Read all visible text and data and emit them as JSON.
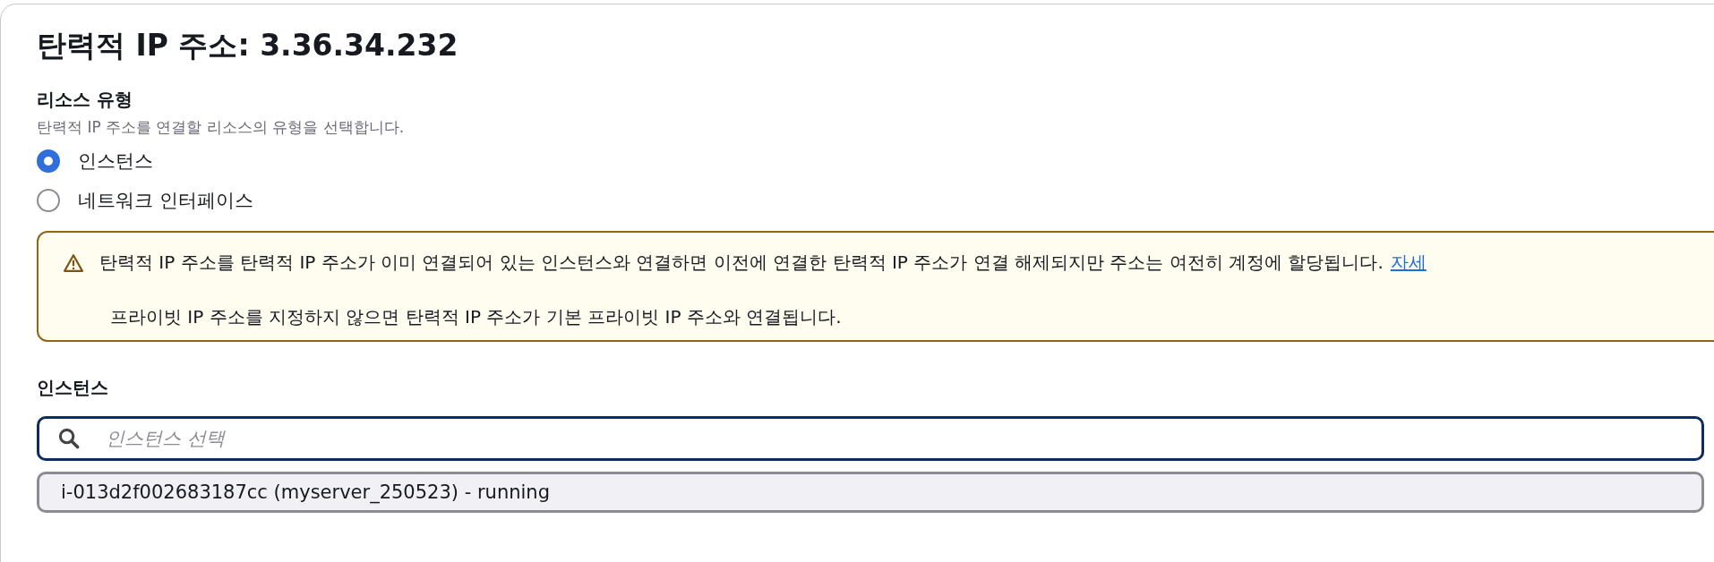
{
  "title": "탄력적 IP 주소: 3.36.34.232",
  "resource_type": {
    "label": "리소스 유형",
    "description": "탄력적 IP 주소를 연결할 리소스의 유형을 선택합니다.",
    "options": [
      {
        "label": "인스턴스",
        "selected": true
      },
      {
        "label": "네트워크 인터페이스",
        "selected": false
      }
    ]
  },
  "alert": {
    "message": "탄력적 IP 주소를 탄력적 IP 주소가 이미 연결되어 있는 인스턴스와 연결하면 이전에 연결한 탄력적 IP 주소가 연결 해제되지만 주소는 여전히 계정에 할당됩니다.",
    "link": "자세",
    "note": "프라이빗 IP 주소를 지정하지 않으면 탄력적 IP 주소가 기본 프라이빗 IP 주소와 연결됩니다."
  },
  "instance": {
    "label": "인스턴스",
    "placeholder": "인스턴스 선택",
    "options": [
      "i-013d2f002683187cc (myserver_250523) - running"
    ]
  }
}
